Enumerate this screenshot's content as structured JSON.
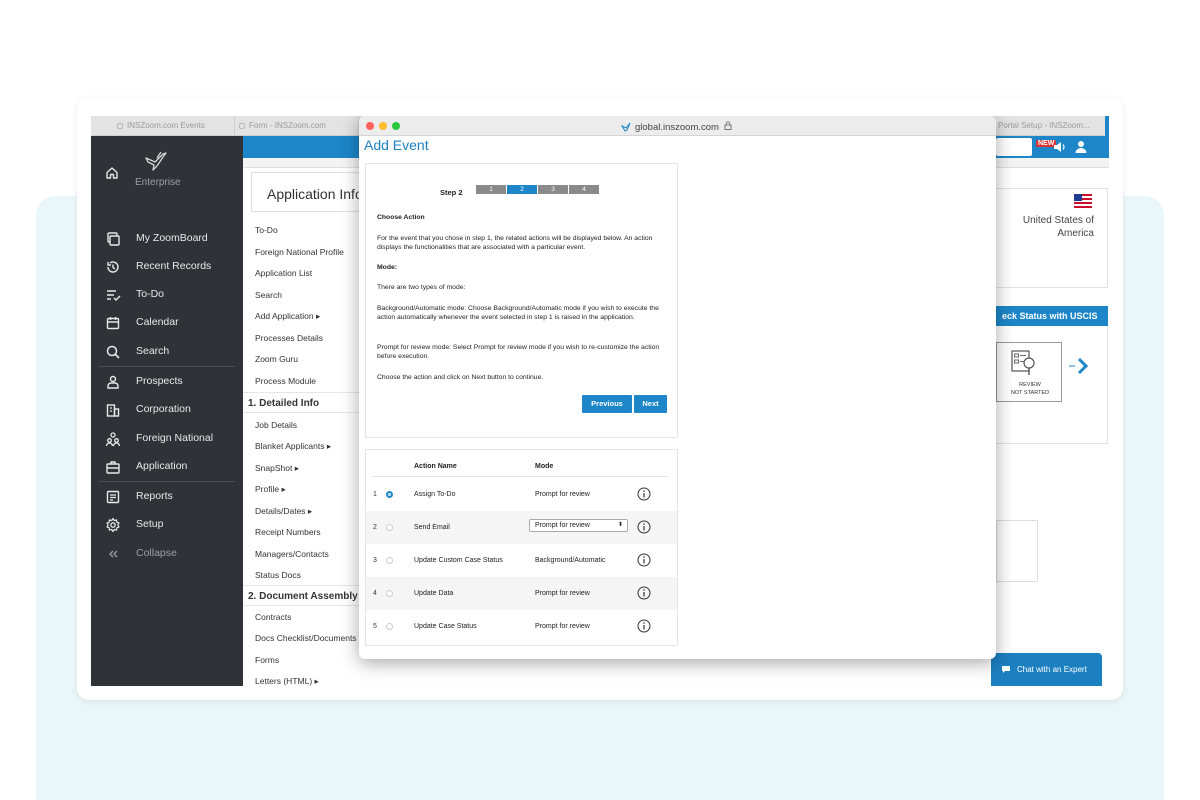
{
  "browser": {
    "tabs": [
      "INSZoom.com Events",
      "Form - INSZoom.com",
      "Portal Setup - INSZoom..."
    ]
  },
  "sidebar": {
    "brand": "Enterprise",
    "items": [
      {
        "label": "My ZoomBoard",
        "icon": "dashboard-icon"
      },
      {
        "label": "Recent Records",
        "icon": "history-icon"
      },
      {
        "label": "To-Do",
        "icon": "todo-list-icon"
      },
      {
        "label": "Calendar",
        "icon": "calendar-icon"
      },
      {
        "label": "Search",
        "icon": "search-icon"
      },
      {
        "label": "Prospects",
        "icon": "person-icon"
      },
      {
        "label": "Corporation",
        "icon": "building-icon"
      },
      {
        "label": "Foreign National",
        "icon": "people-icon"
      },
      {
        "label": "Application",
        "icon": "briefcase-icon"
      },
      {
        "label": "Reports",
        "icon": "report-icon"
      },
      {
        "label": "Setup",
        "icon": "gear-icon"
      },
      {
        "label": "Collapse",
        "icon": "double-chevron-left-icon"
      }
    ]
  },
  "app_info": {
    "title": "Application Info",
    "menu": [
      "To-Do",
      "Foreign National Profile",
      "Application List",
      "Search",
      "Add Application ▸",
      "Processes Details",
      "Zoom Guru",
      "Process Module"
    ],
    "section1": "1. Detailed Info",
    "menu2": [
      "Job Details",
      "Blanket Applicants ▸",
      "SnapShot ▸",
      "Profile ▸",
      "Details/Dates ▸",
      "Receipt Numbers",
      "Managers/Contacts",
      "Status Docs"
    ],
    "section2": "2. Document Assembly",
    "menu3": [
      "Contracts",
      "Docs Checklist/Documents",
      "Forms",
      "Letters (HTML) ▸"
    ]
  },
  "header": {
    "new_badge": "NEW",
    "country": "United States of America",
    "uscis_button": "eck Status with USCIS",
    "review_status": "REVIEW",
    "review_sub": "NOT STARTED",
    "chat_button": "Chat with an Expert"
  },
  "modal": {
    "url": "global.inszoom.com",
    "title": "Add Event",
    "step_label": "Step 2",
    "steps": [
      "1",
      "2",
      "3",
      "4"
    ],
    "active_step": 2,
    "choose_action": "Choose Action",
    "intro": "For the event that you chose in step 1, the related actions will be displayed below. An action displays the functionalities that are associated with a particular event.",
    "mode_heading": "Mode:",
    "mode_types": "There are two types of mode:",
    "mode_background": "Background/Automatic mode: Choose Background/Automatic mode if you wish to execute the action automatically whenever the event selected in step 1 is raised in the application.",
    "mode_prompt": "Prompt for review mode: Select Prompt for review mode if you wish to re-customize the action before execution.",
    "instruction": "Choose the action and click on Next button to continue.",
    "previous_label": "Previous",
    "next_label": "Next",
    "table": {
      "col_action": "Action Name",
      "col_mode": "Mode",
      "rows": [
        {
          "num": "1",
          "name": "Assign To-Do",
          "mode": "Prompt for review",
          "selected": true,
          "dropdown": false
        },
        {
          "num": "2",
          "name": "Send Email",
          "mode": "Prompt for review",
          "selected": false,
          "dropdown": true
        },
        {
          "num": "3",
          "name": "Update Custom Case Status",
          "mode": "Background/Automatic",
          "selected": false,
          "dropdown": false
        },
        {
          "num": "4",
          "name": "Update Data",
          "mode": "Prompt for review",
          "selected": false,
          "dropdown": false
        },
        {
          "num": "5",
          "name": "Update Case Status",
          "mode": "Prompt for review",
          "selected": false,
          "dropdown": false
        }
      ]
    }
  },
  "colors": {
    "accent": "#1c86c8",
    "sidebar_bg": "#2f3337",
    "page_bg": "#eaf7fa"
  }
}
